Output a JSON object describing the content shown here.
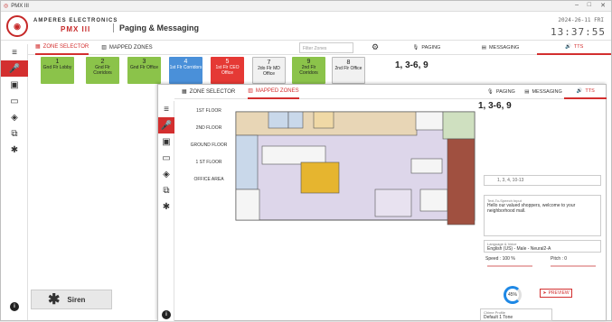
{
  "window": {
    "title": "PMX III"
  },
  "brand": {
    "company": "AMPERES ELECTRONICS",
    "product": "PMX III",
    "logo": "logo-icon"
  },
  "header": {
    "title": "Paging & Messaging",
    "date": "2024-26-11 FRI",
    "time": "13:37:55"
  },
  "main": {
    "tabs": [
      "ZONE SELECTOR",
      "MAPPED ZONES"
    ],
    "filter_placeholder": "Filter Zones",
    "right_tabs": [
      "PAGING",
      "MESSAGING",
      "TTS"
    ],
    "selected_zones": "1, 3-6, 9",
    "zones": [
      {
        "num": "1",
        "name": "Gnd Flr Lobby",
        "color": "green"
      },
      {
        "num": "2",
        "name": "Gnd Flr Corridors",
        "color": "green"
      },
      {
        "num": "3",
        "name": "Gnd Flr Office",
        "color": "green"
      },
      {
        "num": "4",
        "name": "1st Flr Corridors",
        "color": "blue"
      },
      {
        "num": "5",
        "name": "1st Flr CEO Office",
        "color": "red"
      },
      {
        "num": "7",
        "name": "2do Flr MD Office",
        "color": "grey"
      },
      {
        "num": "9",
        "name": "2nd Flr Corridors",
        "color": "green"
      },
      {
        "num": "8",
        "name": "2nd Flr Office",
        "color": "grey"
      }
    ],
    "siren_label": "Siren"
  },
  "second": {
    "tabs": [
      "ZONE SELECTOR",
      "MAPPED ZONES"
    ],
    "floors": [
      "1ST FLOOR",
      "2ND FLOOR",
      "GROUND FLOOR",
      "1 ST FLOOR OFFICE AREA"
    ],
    "right_tabs": [
      "PAGING",
      "MESSAGING",
      "TTS"
    ],
    "selected_zones": "1, 3-6, 9",
    "zone_input": "1, 3, 4, 10-13",
    "tts_label": "Text-To-Speech Input",
    "tts_text": "Hello our valued shoppers, welcome to your neighborhood mall.",
    "voice_label": "Language & Voice",
    "voice_value": "English (US) - Male - Neural2-A",
    "speed": "Speed : 100 %",
    "pitch": "Pitch : 0",
    "speed_level": 0.3,
    "pitch_level": 0.55,
    "progress_text": "45%",
    "progress_value": 0.45,
    "preview_label": "PREVIEW",
    "chime_label": "Chime Profile",
    "chime_value": "Default 1 Tone"
  },
  "colors": {
    "accent": "#d32f2f",
    "green": "#8bc34a",
    "blue": "#4a90d9",
    "red": "#e53935"
  }
}
